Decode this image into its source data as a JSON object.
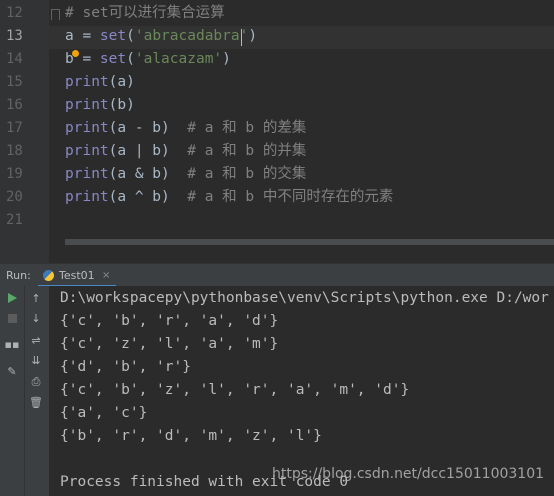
{
  "editor": {
    "gutter": [
      "12",
      "13",
      "14",
      "15",
      "16",
      "17",
      "18",
      "19",
      "20",
      "21"
    ],
    "current_line": "13",
    "lines": [
      [
        {
          "t": "# set可以进行集合运算",
          "c": "cm"
        }
      ],
      [
        {
          "t": "a = ",
          "c": "p"
        },
        {
          "t": "set",
          "c": "kw"
        },
        {
          "t": "(",
          "c": "p"
        },
        {
          "t": "'abracadabra'",
          "c": "str"
        },
        {
          "t": ")",
          "c": "p"
        }
      ],
      [
        {
          "t": "b = ",
          "c": "p"
        },
        {
          "t": "set",
          "c": "kw"
        },
        {
          "t": "(",
          "c": "p"
        },
        {
          "t": "'alacazam'",
          "c": "str"
        },
        {
          "t": ")",
          "c": "p"
        }
      ],
      [
        {
          "t": "print",
          "c": "kw"
        },
        {
          "t": "(a)",
          "c": "p"
        }
      ],
      [
        {
          "t": "print",
          "c": "kw"
        },
        {
          "t": "(b)",
          "c": "p"
        }
      ],
      [
        {
          "t": "print",
          "c": "kw"
        },
        {
          "t": "(a - b)  ",
          "c": "p"
        },
        {
          "t": "# a 和 b 的差集",
          "c": "cm"
        }
      ],
      [
        {
          "t": "print",
          "c": "kw"
        },
        {
          "t": "(a | b)  ",
          "c": "p"
        },
        {
          "t": "# a 和 b 的并集",
          "c": "cm"
        }
      ],
      [
        {
          "t": "print",
          "c": "kw"
        },
        {
          "t": "(a & b)  ",
          "c": "p"
        },
        {
          "t": "# a 和 b 的交集",
          "c": "cm"
        }
      ],
      [
        {
          "t": "print",
          "c": "kw"
        },
        {
          "t": "(a ^ b)  ",
          "c": "p"
        },
        {
          "t": "# a 和 b 中不同时存在的元素",
          "c": "cm"
        }
      ],
      []
    ]
  },
  "run_panel": {
    "label": "Run:",
    "tab_name": "Test01",
    "tab_close": "×"
  },
  "toolbar": {
    "rerun": "run-icon",
    "up": "arrow-up-icon",
    "stop": "stop-icon",
    "down": "arrow-down-icon",
    "layout": "layout-icon",
    "soft_wrap": "soft-wrap-icon",
    "scroll_end": "scroll-to-end-icon",
    "pin": "pin-icon",
    "print": "print-icon",
    "trash": "trash-icon",
    "up_glyph": "↑",
    "down_glyph": "↓",
    "layout_glyph": "▪▪",
    "wrap_glyph": "⇌",
    "scroll_glyph": "⇊",
    "pin_glyph": "✎",
    "print_glyph": "⎙",
    "trash_glyph": "🗑"
  },
  "console": {
    "lines": [
      "D:\\workspacepy\\pythonbase\\venv\\Scripts\\python.exe D:/wor",
      "{'c', 'b', 'r', 'a', 'd'}",
      "{'c', 'z', 'l', 'a', 'm'}",
      "{'d', 'b', 'r'}",
      "{'c', 'b', 'z', 'l', 'r', 'a', 'm', 'd'}",
      "{'a', 'c'}",
      "{'b', 'r', 'd', 'm', 'z', 'l'}",
      "",
      "Process finished with exit code 0"
    ]
  },
  "watermark": "https://blog.csdn.net/dcc15011003101",
  "colors": {
    "background": "#2b2b2b",
    "keyword": "#8888c6",
    "string": "#6a8759",
    "comment": "#808080",
    "text": "#a9b7c6",
    "console_text": "#bbbbbb"
  }
}
